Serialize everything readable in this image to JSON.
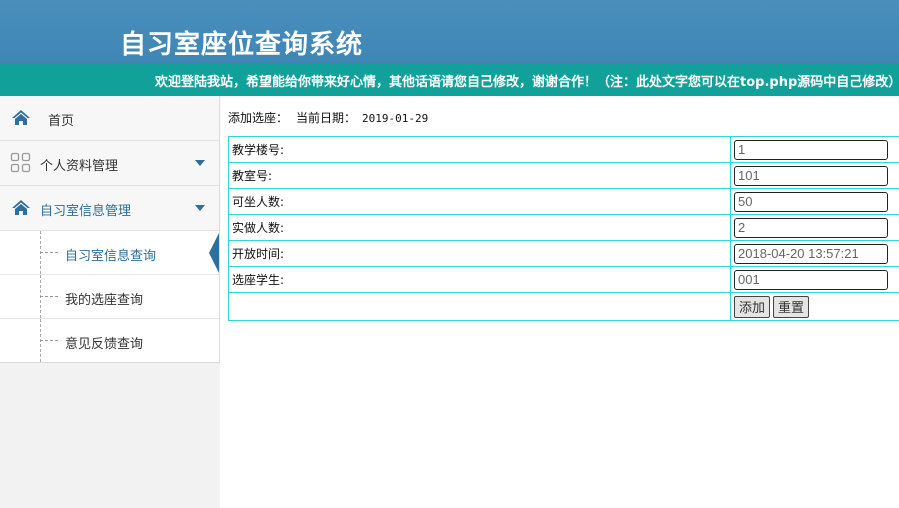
{
  "header": {
    "title": "自习室座位查询系统"
  },
  "marquee": {
    "text": "欢迎登陆我站，希望能给你带来好心情，其他话语请您自己修改，谢谢合作！（注：此处文字您可以在top.php源码中自己修改）"
  },
  "sidebar": {
    "items": [
      {
        "label": "首页",
        "icon": "home-icon"
      },
      {
        "label": "个人资料管理",
        "icon": "grid-icon"
      },
      {
        "label": "自习室信息管理",
        "icon": "home-icon"
      }
    ],
    "submenu": [
      {
        "label": "自习室信息查询"
      },
      {
        "label": "我的选座查询"
      },
      {
        "label": "意见反馈查询"
      }
    ]
  },
  "page": {
    "heading": "添加选座：",
    "date_label": "当前日期：",
    "date_value": "2019-01-29"
  },
  "form": {
    "fields": [
      {
        "label": "教学楼号:",
        "value": "1"
      },
      {
        "label": "教室号:",
        "value": "101"
      },
      {
        "label": "可坐人数:",
        "value": "50"
      },
      {
        "label": "实做人数:",
        "value": "2"
      },
      {
        "label": "开放时间:",
        "value": "2018-04-20 13:57:21"
      },
      {
        "label": "选座学生:",
        "value": "001"
      }
    ],
    "add_label": "添加",
    "reset_label": "重置"
  },
  "colors": {
    "header_blue": "#4a8fbc",
    "marquee_teal": "#12a09a",
    "accent_blue": "#2e6f9e",
    "table_border": "#33d6d6"
  }
}
